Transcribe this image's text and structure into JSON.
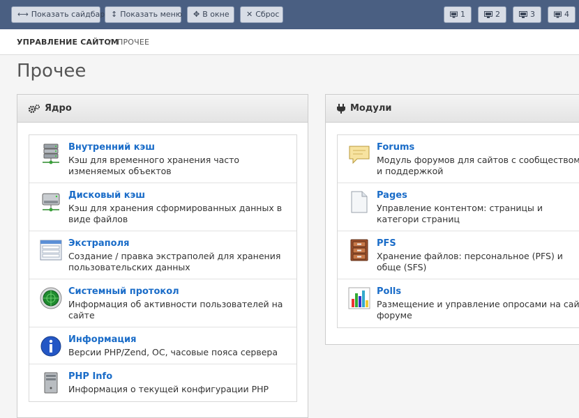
{
  "toolbar": {
    "show_sidebar": "Показать сайдбар",
    "show_menu": "Показать меню",
    "in_window": "В окне",
    "reset": "Сброс",
    "screens": [
      "1",
      "2",
      "3",
      "4"
    ]
  },
  "breadcrumb": {
    "root": "УПРАВЛЕНИЕ САЙТОМ",
    "separator": "/",
    "current": "ПРОЧЕЕ"
  },
  "page_title": "Прочее",
  "core_panel": {
    "title": "Ядро",
    "items": [
      {
        "title": "Внутренний кэш",
        "desc": "Кэш для временного хранения часто изменяемых объектов",
        "icon": "server-icon"
      },
      {
        "title": "Дисковый кэш",
        "desc": "Кэш для хранения сформированных данных в виде файлов",
        "icon": "disk-drive-icon"
      },
      {
        "title": "Экстраполя",
        "desc": "Создание / правка экстраполей для хранения пользовательских данных",
        "icon": "form-fields-icon"
      },
      {
        "title": "Системный протокол",
        "desc": "Информация об активности пользователей на сайте",
        "icon": "radar-icon"
      },
      {
        "title": "Информация",
        "desc": "Версии PHP/Zend, ОС, часовые пояса сервера",
        "icon": "info-icon"
      },
      {
        "title": "PHP Info",
        "desc": "Информация о текущей конфигурации PHP",
        "icon": "computer-tower-icon"
      }
    ]
  },
  "modules_panel": {
    "title": "Модули",
    "items": [
      {
        "title": "Forums",
        "desc": "Модуль форумов для сайтов с сообществом и поддержкой",
        "icon": "speech-bubble-icon"
      },
      {
        "title": "Pages",
        "desc": "Управление контентом: страницы и категори страниц",
        "icon": "document-icon"
      },
      {
        "title": "PFS",
        "desc": "Хранение файлов: персональное (PFS) и обще (SFS)",
        "icon": "file-cabinet-icon"
      },
      {
        "title": "Polls",
        "desc": "Размещение и управление опросами на сайт форуме",
        "icon": "bar-chart-icon"
      }
    ]
  }
}
